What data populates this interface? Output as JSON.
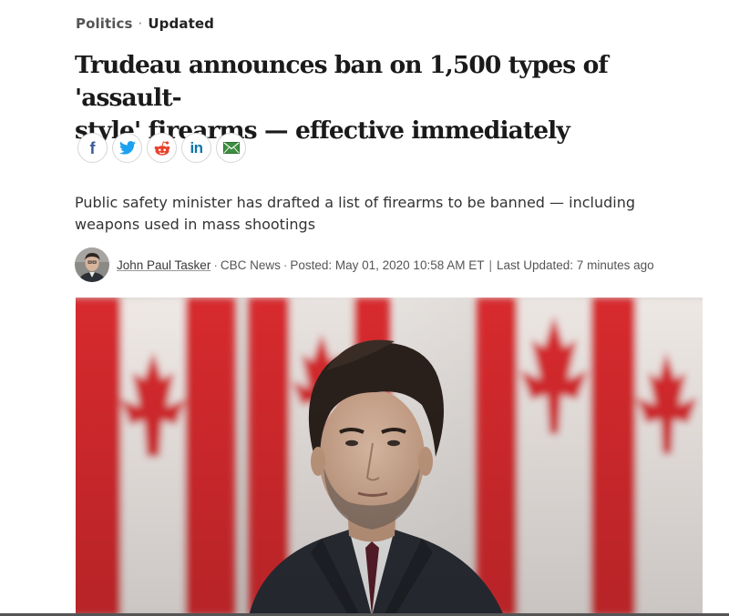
{
  "article": {
    "category": "Politics",
    "separator": "·",
    "status": "Updated",
    "headline_line1": "Trudeau announces ban on 1,500 types of 'assault-",
    "headline_line2": "style' firearms — effective immediately",
    "deck_line1": "Public safety minister has drafted a list of firearms to be banned — including",
    "deck_line2": "weapons used in mass shootings"
  },
  "share": {
    "buttons": [
      {
        "icon": "facebook-icon",
        "glyph": "f",
        "color": "#3b5998"
      },
      {
        "icon": "twitter-icon",
        "color": "#1da1f2"
      },
      {
        "icon": "reddit-icon",
        "color": "#e8412c"
      },
      {
        "icon": "linkedin-icon",
        "glyph": "in",
        "color": "#0e76a8"
      },
      {
        "icon": "email-icon",
        "color": "#3e8e41"
      }
    ]
  },
  "byline": {
    "author": "John Paul Tasker",
    "dot": "·",
    "source": "CBC News",
    "posted": "Posted: May 01, 2020 10:58 AM ET",
    "bar": "|",
    "updated": "Last Updated: 7 minutes ago"
  },
  "colors": {
    "flag_red": "#d9262b",
    "text_primary": "#1a1a1a",
    "text_secondary": "#555555"
  }
}
